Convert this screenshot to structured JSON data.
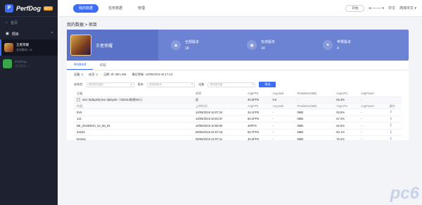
{
  "app": {
    "name": "PerfDog",
    "badge": "BETA",
    "logo_letter": "P"
  },
  "sidebar": {
    "items": [
      {
        "label": "首页",
        "icon": "home-icon"
      },
      {
        "label": "项目",
        "icon": "folder-icon"
      }
    ],
    "apps": [
      {
        "title": "王者荣耀",
        "sub": "支持版本: 18",
        "selected": true
      },
      {
        "title": "PerfDog",
        "sub": "测试版本: 1",
        "selected": false
      }
    ]
  },
  "topbar": {
    "tabs": [
      "我的数据",
      "任务数据",
      "管理"
    ],
    "right_button": "开始",
    "user": "a——— ▾",
    "lang": "中文",
    "extra": "简体中文 ▾"
  },
  "crumb": "我的数据 > 项目",
  "banner": {
    "game": "王者荣耀",
    "stats": [
      {
        "label": "全部版本",
        "value": "18",
        "icon": "cube-icon"
      },
      {
        "label": "安卓版本",
        "value": "14",
        "icon": "android-icon"
      },
      {
        "label": "苹果版本",
        "value": "4",
        "icon": "apple-icon"
      }
    ]
  },
  "subtabs": [
    "Android",
    "iOS"
  ],
  "info": [
    "设备: 1",
    "成员: 1",
    "日期: 0h 30m 49s",
    "最近更新: 14/05/2019 16:17:13"
  ],
  "filters": {
    "labels": [
      "安装包",
      "版本",
      "设备"
    ],
    "placeholders": [
      "请选择安装包",
      "请选择版本",
      "请选择设备"
    ],
    "button": "筛选"
  },
  "table": {
    "headers": [
      "设备",
      "帧率",
      "AvgFPS",
      "AvgJank",
      "PeakMem(MB)",
      "AvgCPU",
      "AvgPower"
    ],
    "group": {
      "device": "vivo Xplay3S(vivo Xplay3S（X520L/联想4G）)",
      "fps": "低",
      "avg_fps": "40.3FPS",
      "jank": "0.0",
      "mem": "-",
      "cpu": "62.3%",
      "power": "-"
    },
    "sub_headers": [
      "内容",
      "上传时间",
      "AvgFPS",
      "AvgJank",
      "PeakMem(MB)",
      "AvgCPU",
      "AvgPower",
      "操作"
    ],
    "rows": [
      [
        "5V5",
        "14/05/2019 16:07:24",
        "34.1FPS",
        "-",
        "0MB",
        "63.5%",
        "-"
      ],
      [
        "121",
        "13/05/2019 10:03:37",
        "50.4FPS",
        "-",
        "0MB",
        "67.2%",
        "-"
      ],
      [
        "BE_20190510_10_59_03",
        "10/05/2019 10:59:00",
        "40FPS",
        "-",
        "0MB",
        "62.6%",
        "-"
      ],
      [
        "33333",
        "09/05/2019 22:07:19",
        "50.7FPS",
        "-",
        "0MB",
        "84.1%",
        "-"
      ],
      [
        "test111",
        "09/05/2019 22:07:11",
        "46.3FPS",
        "-",
        "0MB",
        "76.4%",
        "-"
      ]
    ]
  },
  "watermark": "pc6"
}
